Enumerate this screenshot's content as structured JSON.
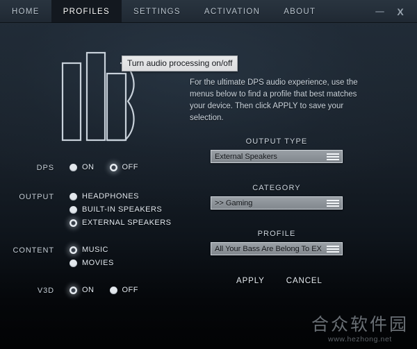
{
  "window": {
    "tabs": [
      {
        "label": "HOME",
        "active": false
      },
      {
        "label": "PROFILES",
        "active": true
      },
      {
        "label": "SETTINGS",
        "active": false
      },
      {
        "label": "ACTIVATION",
        "active": false
      },
      {
        "label": "ABOUT",
        "active": false
      }
    ],
    "controls": {
      "minimize": "minimize-icon",
      "close": "X"
    }
  },
  "tooltip": {
    "text": "Turn audio processing on/off"
  },
  "logo": {
    "name": "dps-logo"
  },
  "description": {
    "text": "For the ultimate DPS audio experience, use the menus below to find a profile that best matches your device. Then click APPLY to save your selection."
  },
  "controls": {
    "dps": {
      "label": "DPS",
      "layout": "horizontal",
      "options": [
        {
          "label": "ON",
          "selected": false
        },
        {
          "label": "OFF",
          "selected": true
        }
      ]
    },
    "output": {
      "label": "OUTPUT",
      "layout": "vertical",
      "options": [
        {
          "label": "HEADPHONES",
          "selected": false
        },
        {
          "label": "BUILT-IN SPEAKERS",
          "selected": false
        },
        {
          "label": "EXTERNAL SPEAKERS",
          "selected": true
        }
      ]
    },
    "content": {
      "label": "CONTENT",
      "layout": "vertical",
      "options": [
        {
          "label": "MUSIC",
          "selected": true
        },
        {
          "label": "MOVIES",
          "selected": false
        }
      ]
    },
    "v3d": {
      "label": "V3D",
      "layout": "horizontal",
      "options": [
        {
          "label": "ON",
          "selected": true
        },
        {
          "label": "OFF",
          "selected": false
        }
      ]
    }
  },
  "dropdowns": {
    "output_type": {
      "title": "OUTPUT TYPE",
      "value": "External Speakers",
      "icon": "menu-lines-icon"
    },
    "category": {
      "title": "CATEGORY",
      "value": ">> Gaming",
      "icon": "menu-lines-icon"
    },
    "profile": {
      "title": "PROFILE",
      "value": "All Your Bass Are Belong To EX",
      "icon": "menu-lines-icon"
    }
  },
  "actions": {
    "apply": "APPLY",
    "cancel": "CANCEL"
  },
  "watermark": {
    "cn": "合众软件园",
    "url": "www.hezhong.net"
  },
  "colors": {
    "background_top": "#222d39",
    "background_bottom": "#020304",
    "titlebar": "#242e39",
    "active_tab": "#13181f",
    "text_primary": "#e3eaf1",
    "text_muted": "#b9c4ce",
    "dropdown_fill": "#8d9399",
    "tooltip_fill": "#e2e3e5"
  }
}
